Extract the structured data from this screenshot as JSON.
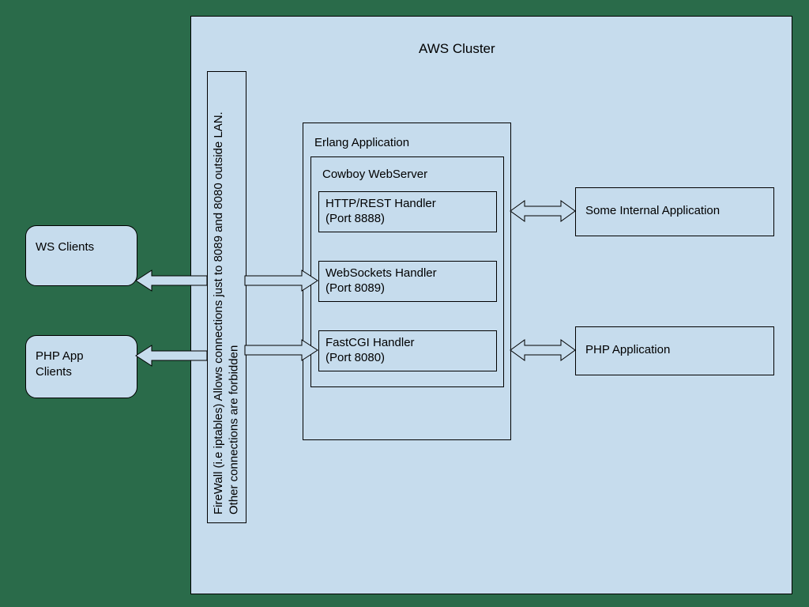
{
  "cluster": {
    "title": "AWS Cluster"
  },
  "clients": {
    "ws": "WS Clients",
    "php": "PHP App Clients"
  },
  "firewall": {
    "text": "FireWall (i.e iptables) Allows connections just to 8089 and 8080 outside LAN. Other connections are forbidden"
  },
  "erlang": {
    "title": "Erlang Application",
    "cowboy": {
      "title": "Cowboy WebServer",
      "handlers": {
        "http": {
          "name": "HTTP/REST Handler",
          "port": "(Port 8888)"
        },
        "ws": {
          "name": "WebSockets Handler",
          "port": "(Port 8089)"
        },
        "fastcgi": {
          "name": "FastCGI Handler",
          "port": "(Port 8080)"
        }
      }
    }
  },
  "apps": {
    "internal": "Some Internal Application",
    "php": "PHP Application"
  }
}
